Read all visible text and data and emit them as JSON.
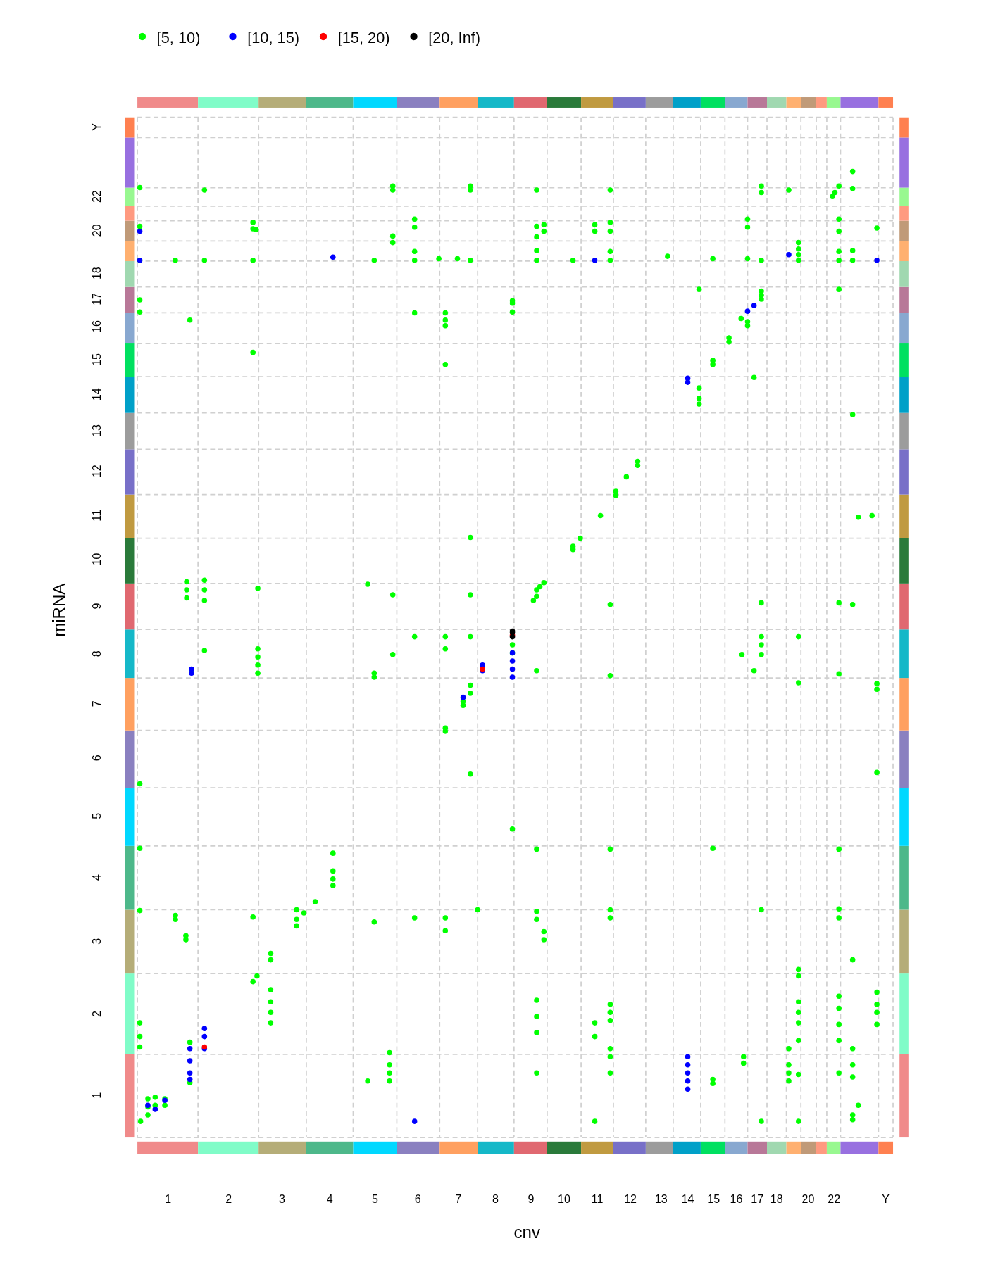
{
  "legend": [
    {
      "label": "[5, 10)",
      "color": "#00ff00"
    },
    {
      "label": "[10, 15)",
      "color": "#0000ff"
    },
    {
      "label": "[15, 20)",
      "color": "#ff0000"
    },
    {
      "label": "[20, Inf)",
      "color": "#000000"
    }
  ],
  "plot": {
    "x_title": "cnv",
    "y_title": "miRNA",
    "x_labels": [
      "1",
      "2",
      "3",
      "4",
      "5",
      "6",
      "7",
      "8",
      "9",
      "10",
      "11",
      "12",
      "13",
      "14",
      "15",
      "16",
      "17",
      "18",
      "20",
      "22",
      "Y"
    ],
    "y_labels": [
      "1",
      "2",
      "3",
      "4",
      "5",
      "6",
      "7",
      "8",
      "9",
      "10",
      "11",
      "12",
      "13",
      "14",
      "15",
      "16",
      "17",
      "18",
      "20",
      "22",
      "Y"
    ]
  }
}
